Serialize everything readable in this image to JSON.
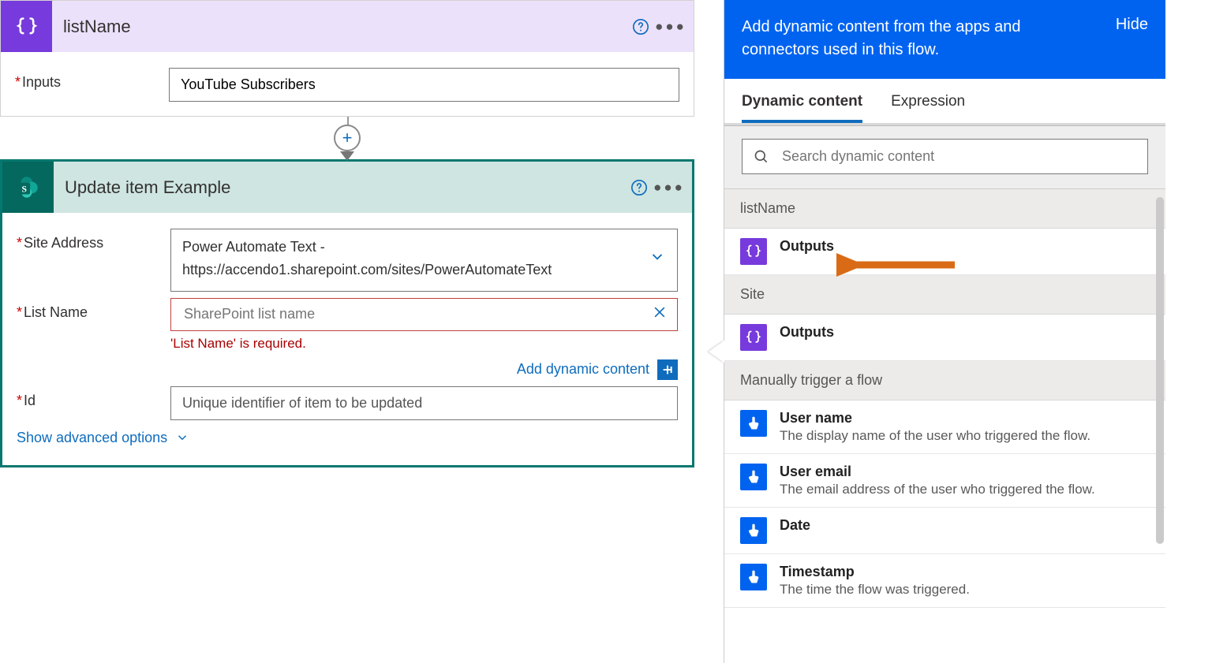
{
  "compose": {
    "title": "listName",
    "inputsLabel": "Inputs",
    "inputsValue": "YouTube Subscribers"
  },
  "updateItem": {
    "title": "Update item Example",
    "siteAddressLabel": "Site Address",
    "siteAddressLine1": "Power Automate Text -",
    "siteAddressLine2": "https://accendo1.sharepoint.com/sites/PowerAutomateText",
    "listNameLabel": "List Name",
    "listNamePlaceholder": "SharePoint list name",
    "listNameError": "'List Name' is required.",
    "idLabel": "Id",
    "idPlaceholder": "Unique identifier of item to be updated",
    "addDynamicLabel": "Add dynamic content",
    "showAdvancedLabel": "Show advanced options"
  },
  "dynPanel": {
    "headerText": "Add dynamic content from the apps and connectors used in this flow.",
    "hideLabel": "Hide",
    "tabDynamic": "Dynamic content",
    "tabExpression": "Expression",
    "searchPlaceholder": "Search dynamic content",
    "groups": [
      {
        "title": "listName",
        "items": [
          {
            "name": "Outputs",
            "desc": "",
            "iconClass": "ico-purple"
          }
        ]
      },
      {
        "title": "Site",
        "items": [
          {
            "name": "Outputs",
            "desc": "",
            "iconClass": "ico-purple"
          }
        ]
      },
      {
        "title": "Manually trigger a flow",
        "items": [
          {
            "name": "User name",
            "desc": "The display name of the user who triggered the flow.",
            "iconClass": "ico-blue"
          },
          {
            "name": "User email",
            "desc": "The email address of the user who triggered the flow.",
            "iconClass": "ico-blue"
          },
          {
            "name": "Date",
            "desc": "",
            "iconClass": "ico-blue"
          },
          {
            "name": "Timestamp",
            "desc": "The time the flow was triggered.",
            "iconClass": "ico-blue"
          }
        ]
      }
    ]
  }
}
